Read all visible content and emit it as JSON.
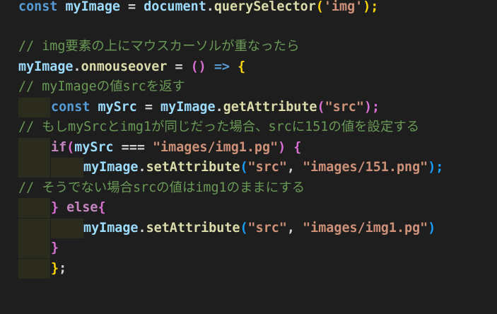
{
  "code_lines": [
    {
      "id": "l1",
      "tokens": [
        "const",
        " ",
        "myImage",
        " = ",
        "document",
        ".",
        "querySelector",
        "(",
        "'img'",
        ");"
      ]
    },
    {
      "id": "l2",
      "tokens": []
    },
    {
      "id": "l3",
      "tokens": [
        "// img要素の上にマウスカーソルが重なったら"
      ]
    },
    {
      "id": "l4",
      "tokens": [
        "myImage",
        ".",
        "onmouseover",
        " = ",
        "()",
        " => ",
        "{"
      ]
    },
    {
      "id": "l5",
      "tokens": [
        "// myImageの値srcを返す"
      ]
    },
    {
      "id": "l6",
      "tokens": [
        "const",
        " ",
        "mySrc",
        " = ",
        "myImage",
        ".",
        "getAttribute",
        "(",
        "\"src\"",
        ");"
      ]
    },
    {
      "id": "l7",
      "tokens": [
        "// もしmySrcとimg1が同じだった場合、srcに151の値を設定する"
      ]
    },
    {
      "id": "l8",
      "tokens": [
        "if",
        "(",
        "mySrc",
        " === ",
        "\"images/img1.pg\"",
        ")",
        " ",
        "{"
      ]
    },
    {
      "id": "l9",
      "tokens": [
        "myImage",
        ".",
        "setAttribute",
        "(",
        "\"src\"",
        ", ",
        "\"images/151.png\"",
        ");"
      ]
    },
    {
      "id": "l10",
      "tokens": [
        "// そうでない場合srcの値はimg1のままにする"
      ]
    },
    {
      "id": "l11",
      "tokens": [
        "}",
        " ",
        "else",
        "{"
      ]
    },
    {
      "id": "l12",
      "tokens": [
        "myImage",
        ".",
        "setAttribute",
        "(",
        "\"src\"",
        ", ",
        "\"images/img1.pg\"",
        ")"
      ]
    },
    {
      "id": "l13",
      "tokens": [
        "}"
      ]
    },
    {
      "id": "l14",
      "tokens": [
        "}",
        ";"
      ]
    }
  ]
}
